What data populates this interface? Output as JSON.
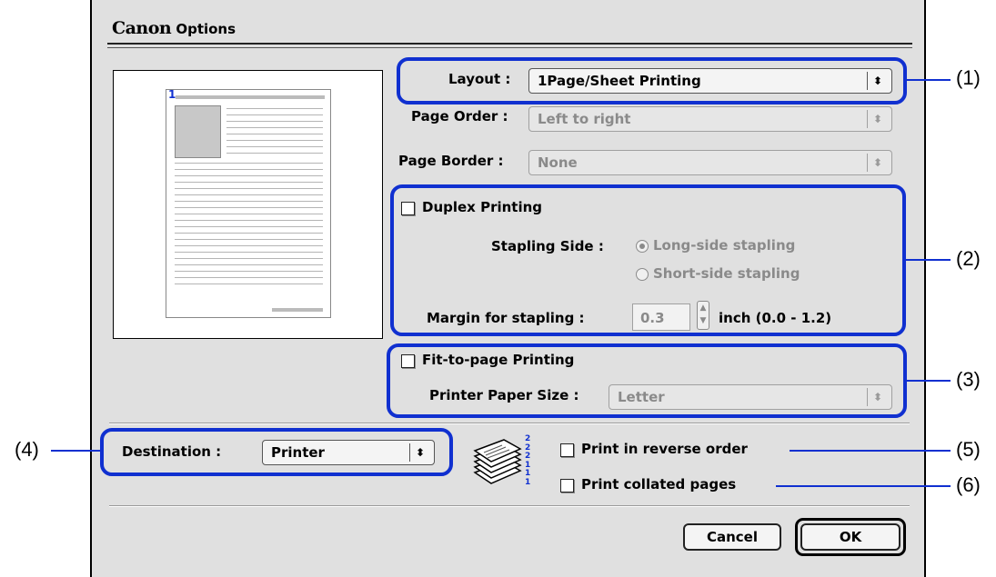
{
  "window": {
    "title_brand": "Canon",
    "title": "Options"
  },
  "layout": {
    "label": "Layout :",
    "value": "1Page/Sheet Printing"
  },
  "page_order": {
    "label": "Page Order :",
    "value": "Left to right"
  },
  "page_border": {
    "label": "Page Border :",
    "value": "None"
  },
  "preview": {
    "page_number": "1"
  },
  "duplex": {
    "label": "Duplex Printing",
    "checked": false,
    "stapling_side_label": "Stapling Side :",
    "options": [
      "Long-side stapling",
      "Short-side stapling"
    ],
    "selected": "Long-side stapling",
    "margin_label": "Margin for stapling :",
    "margin_value": "0.3",
    "margin_unit": "inch (0.0 - 1.2)"
  },
  "fit_to_page": {
    "label": "Fit-to-page Printing",
    "checked": false,
    "paper_size_label": "Printer Paper Size :",
    "paper_size_value": "Letter"
  },
  "destination": {
    "label": "Destination :",
    "value": "Printer"
  },
  "stack_icon_digits": "2\n2\n2\n1\n1\n1",
  "reverse_order": {
    "label": "Print in reverse order",
    "checked": false
  },
  "collated": {
    "label": "Print collated pages",
    "checked": false
  },
  "buttons": {
    "cancel": "Cancel",
    "ok": "OK"
  },
  "callouts": [
    "(1)",
    "(2)",
    "(3)",
    "(4)",
    "(5)",
    "(6)"
  ],
  "colors": {
    "highlight": "#1030d0",
    "dialog_bg": "#e0e0e0",
    "disabled_text": "#8a8a8a"
  }
}
